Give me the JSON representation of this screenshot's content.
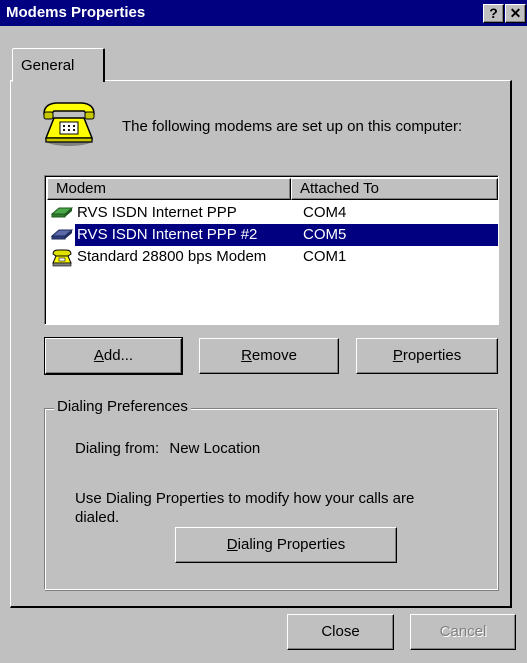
{
  "window": {
    "title": "Modems Properties",
    "help_label": "?",
    "close_label": "✕"
  },
  "tabs": [
    {
      "label": "General",
      "active": true
    }
  ],
  "intro_text": "The following modems are set up on this computer:",
  "modem_list": {
    "columns": [
      "Modem",
      "Attached To"
    ],
    "rows": [
      {
        "name": "RVS ISDN Internet PPP",
        "port": "COM4",
        "icon": "isdn-adapter-icon",
        "selected": false
      },
      {
        "name": "RVS ISDN Internet PPP #2",
        "port": "COM5",
        "icon": "isdn-adapter-icon",
        "selected": true
      },
      {
        "name": "Standard 28800 bps Modem",
        "port": "COM1",
        "icon": "modem-icon",
        "selected": false
      }
    ]
  },
  "buttons": {
    "add": {
      "pre": "",
      "ul": "A",
      "post": "dd..."
    },
    "remove": {
      "pre": "",
      "ul": "R",
      "post": "emove"
    },
    "properties": {
      "pre": "",
      "ul": "P",
      "post": "roperties"
    }
  },
  "dialing": {
    "legend": "Dialing Preferences",
    "from_label": "Dialing from:",
    "from_value": "New Location",
    "info_line1": "Use Dialing Properties to modify how your calls are",
    "info_line2": "dialed.",
    "button": {
      "pre": "",
      "ul": "D",
      "post": "ialing Properties"
    }
  },
  "footer": {
    "close_label": "Close",
    "cancel_label": "Cancel",
    "cancel_enabled": false
  },
  "colors": {
    "titlebar": "#000080",
    "selection": "#000080",
    "face": "#c0c0c0"
  }
}
